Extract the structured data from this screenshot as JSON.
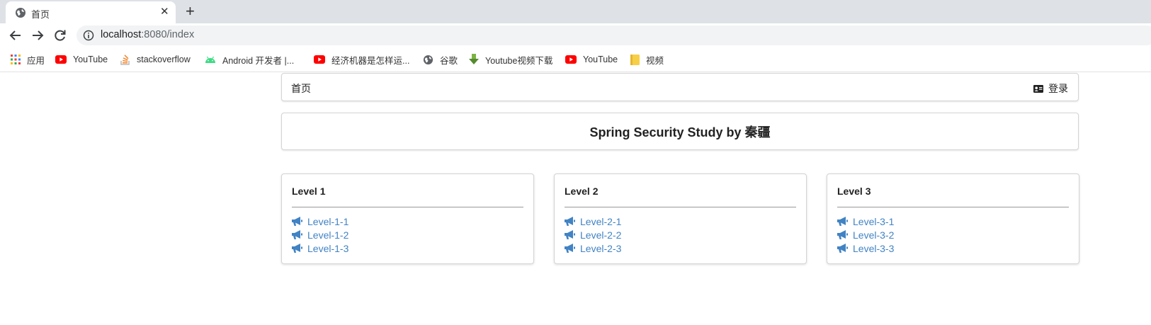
{
  "browser": {
    "tab": {
      "title": "首页",
      "close": "✕"
    },
    "new_tab": "+",
    "omnibox": {
      "host": "localhost",
      "rest": ":8080/index"
    },
    "bookmarks": [
      {
        "label": "应用",
        "icon": "apps-grid-icon"
      },
      {
        "label": "YouTube",
        "icon": "youtube-icon"
      },
      {
        "label": "stackoverflow",
        "icon": "stackoverflow-icon"
      },
      {
        "label": "Android 开发者  |...",
        "icon": "android-icon"
      },
      {
        "label": "经济机器是怎样运...",
        "icon": "youtube-icon"
      },
      {
        "label": "谷歌",
        "icon": "globe-icon"
      },
      {
        "label": "Youtube视频下载",
        "icon": "download-icon"
      },
      {
        "label": "YouTube",
        "icon": "youtube-icon"
      },
      {
        "label": "视频",
        "icon": "folder-icon"
      }
    ]
  },
  "page": {
    "navbar": {
      "home": "首页",
      "login": "登录"
    },
    "hero_title": "Spring Security Study by 秦疆",
    "cards": [
      {
        "title": "Level 1",
        "links": [
          "Level-1-1",
          "Level-1-2",
          "Level-1-3"
        ]
      },
      {
        "title": "Level 2",
        "links": [
          "Level-2-1",
          "Level-2-2",
          "Level-2-3"
        ]
      },
      {
        "title": "Level 3",
        "links": [
          "Level-3-1",
          "Level-3-2",
          "Level-3-3"
        ]
      }
    ]
  },
  "colors": {
    "link": "#4183c4",
    "youtube": "#ff0000",
    "android": "#3ddc84",
    "stackoverflow": "#f48024",
    "folder": "#f7cf46"
  }
}
